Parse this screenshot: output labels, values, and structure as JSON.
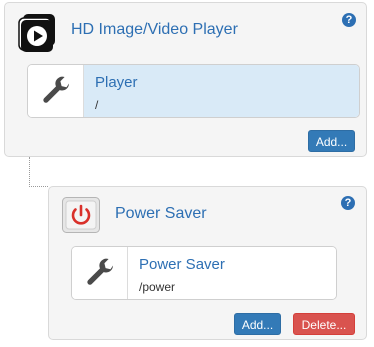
{
  "modules": [
    {
      "title": "HD Image/Video Player",
      "icon": "play-video-icon",
      "help_label": "?",
      "plugin": {
        "name": "Player",
        "path": "/",
        "icon": "wrench-icon",
        "selected": true
      },
      "buttons": {
        "add": "Add..."
      }
    },
    {
      "title": "Power Saver",
      "icon": "power-icon",
      "help_label": "?",
      "plugin": {
        "name": "Power Saver",
        "path": "/power",
        "icon": "wrench-icon",
        "selected": false
      },
      "buttons": {
        "add": "Add...",
        "delete": "Delete..."
      }
    }
  ],
  "colors": {
    "accent": "#2d6fb3",
    "selected_bg": "#d9eaf7",
    "add_button": "#337ab7",
    "delete_button": "#d9534f",
    "power_red": "#d9302a"
  }
}
